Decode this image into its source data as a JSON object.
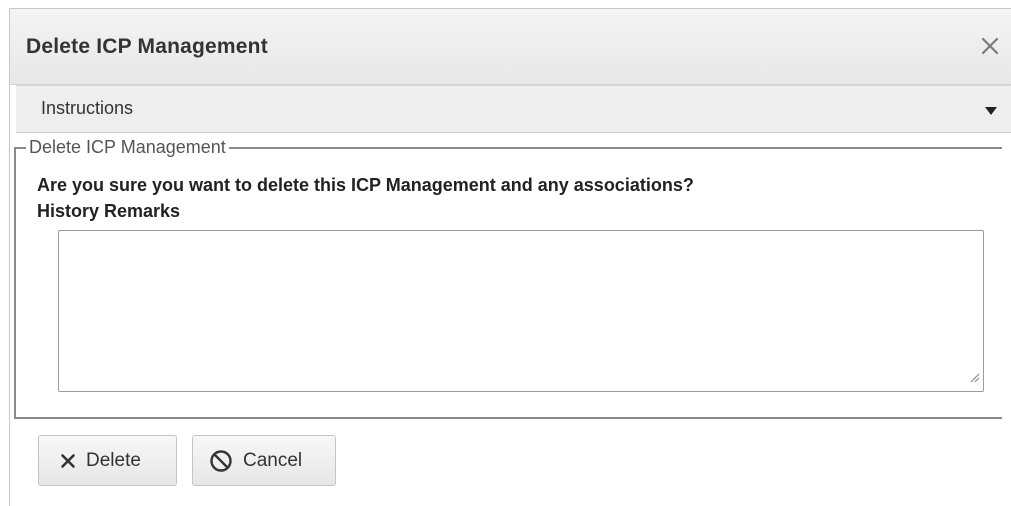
{
  "dialog": {
    "title": "Delete ICP Management",
    "close_icon": "close-icon"
  },
  "instructions": {
    "label": "Instructions",
    "caret_icon": "caret-down-icon"
  },
  "form": {
    "legend": "Delete ICP Management",
    "question": "Are you sure you want to delete this ICP Management and any associations?",
    "remarks_label": "History Remarks",
    "remarks_value": ""
  },
  "buttons": {
    "delete_label": "Delete",
    "delete_icon": "x-icon",
    "cancel_label": "Cancel",
    "cancel_icon": "ban-icon"
  }
}
